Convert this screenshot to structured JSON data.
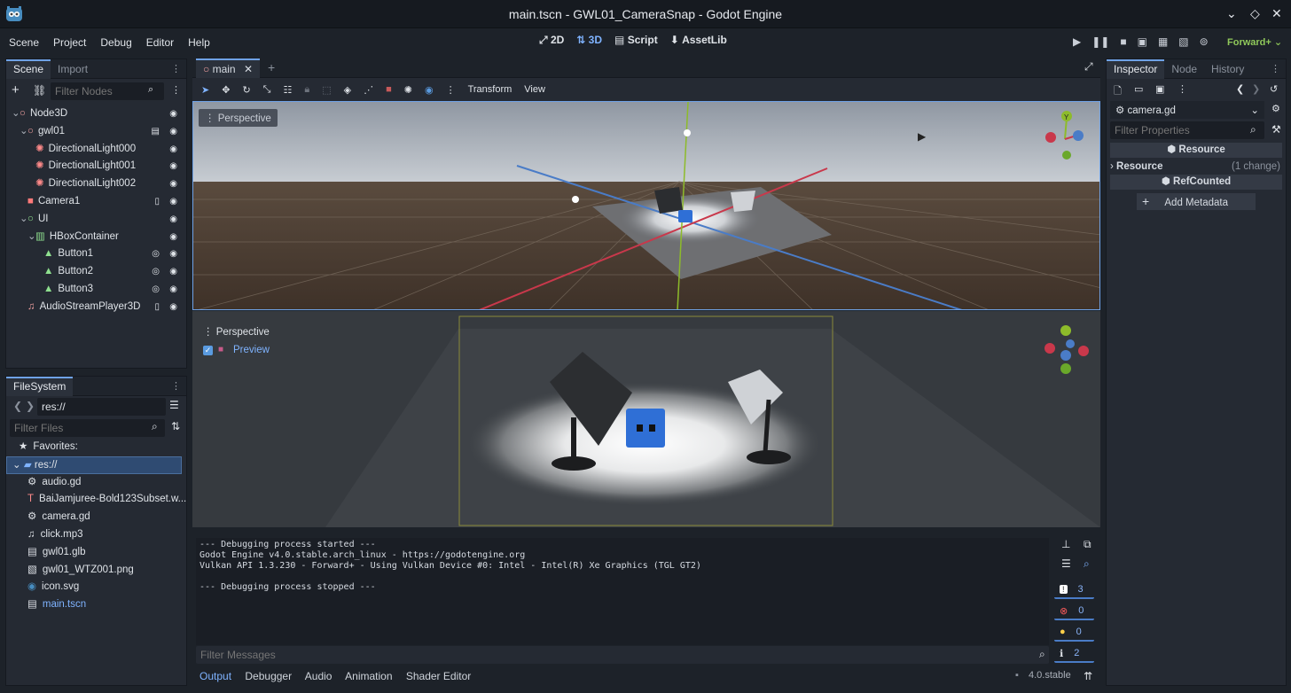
{
  "titlebar": {
    "title": "main.tscn - GWL01_CameraSnap - Godot Engine"
  },
  "menu": [
    "Scene",
    "Project",
    "Debug",
    "Editor",
    "Help"
  ],
  "workspaces": [
    "2D",
    "3D",
    "Script",
    "AssetLib"
  ],
  "renderer": "Forward+",
  "scene_dock": {
    "tabs": [
      "Scene",
      "Import"
    ],
    "filter_placeholder": "Filter Nodes",
    "nodes": [
      {
        "label": "Node3D",
        "indent": 0,
        "icon": "node3d-icon",
        "color": "#f0a0a0",
        "arrow": "⌄",
        "badge": ""
      },
      {
        "label": "gwl01",
        "indent": 1,
        "icon": "node3d-icon",
        "color": "#f0a0a0",
        "arrow": "⌄",
        "badge": "clapper"
      },
      {
        "label": "DirectionalLight000",
        "indent": 2,
        "icon": "light-icon",
        "color": "#ff8a8a",
        "arrow": "",
        "badge": ""
      },
      {
        "label": "DirectionalLight001",
        "indent": 2,
        "icon": "light-icon",
        "color": "#ff8a8a",
        "arrow": "",
        "badge": ""
      },
      {
        "label": "DirectionalLight002",
        "indent": 2,
        "icon": "light-icon",
        "color": "#ff8a8a",
        "arrow": "",
        "badge": ""
      },
      {
        "label": "Camera1",
        "indent": 1,
        "icon": "camera-icon",
        "color": "#ff7a7a",
        "arrow": "",
        "badge": "script"
      },
      {
        "label": "UI",
        "indent": 1,
        "icon": "control-icon",
        "color": "#8fe08f",
        "arrow": "⌄",
        "badge": ""
      },
      {
        "label": "HBoxContainer",
        "indent": 2,
        "icon": "hbox-icon",
        "color": "#8fe08f",
        "arrow": "⌄",
        "badge": ""
      },
      {
        "label": "Button1",
        "indent": 3,
        "icon": "button-icon",
        "color": "#8fe08f",
        "arrow": "",
        "badge": "signal"
      },
      {
        "label": "Button2",
        "indent": 3,
        "icon": "button-icon",
        "color": "#8fe08f",
        "arrow": "",
        "badge": "signal"
      },
      {
        "label": "Button3",
        "indent": 3,
        "icon": "button-icon",
        "color": "#8fe08f",
        "arrow": "",
        "badge": "signal"
      },
      {
        "label": "AudioStreamPlayer3D",
        "indent": 1,
        "icon": "audio-icon",
        "color": "#f0a0a0",
        "arrow": "",
        "badge": "script"
      }
    ]
  },
  "filesystem": {
    "tab": "FileSystem",
    "path": "res://",
    "filter_placeholder": "Filter Files",
    "favorites_label": "Favorites:",
    "root_label": "res://",
    "files": [
      {
        "label": "audio.gd",
        "icon": "gear-icon",
        "color": "#dfe3e8"
      },
      {
        "label": "BaiJamjuree-Bold123Subset.w...",
        "icon": "font-icon",
        "color": "#dfe3e8"
      },
      {
        "label": "camera.gd",
        "icon": "gear-icon",
        "color": "#dfe3e8"
      },
      {
        "label": "click.mp3",
        "icon": "music-icon",
        "color": "#dfe3e8"
      },
      {
        "label": "gwl01.glb",
        "icon": "scene-icon",
        "color": "#dfe3e8"
      },
      {
        "label": "gwl01_WTZ001.png",
        "icon": "image-icon",
        "color": "#dfe3e8"
      },
      {
        "label": "icon.svg",
        "icon": "godot-icon",
        "color": "#dfe3e8"
      },
      {
        "label": "main.tscn",
        "icon": "scene-icon",
        "color": "#7fb3ff"
      }
    ]
  },
  "editor_tab": "main",
  "viewport_toolbar": {
    "transform_label": "Transform",
    "view_label": "View"
  },
  "viewport_top": {
    "label": "Perspective"
  },
  "viewport_bottom": {
    "label": "Perspective",
    "preview_label": "Preview"
  },
  "gizmo": {
    "y": "Y",
    "x": "X",
    "z": "Z"
  },
  "console": {
    "lines": [
      "--- Debugging process started ---",
      "Godot Engine v4.0.stable.arch_linux - https://godotengine.org",
      "Vulkan API 1.3.230 - Forward+ - Using Vulkan Device #0: Intel - Intel(R) Xe Graphics (TGL GT2)",
      "",
      "--- Debugging process stopped ---"
    ],
    "filter_placeholder": "Filter Messages",
    "counts": {
      "messages": "3",
      "errors": "0",
      "warnings": "0",
      "info": "2"
    }
  },
  "bottom_tabs": [
    "Output",
    "Debugger",
    "Audio",
    "Animation",
    "Shader Editor"
  ],
  "version": "4.0.stable",
  "inspector": {
    "tabs": [
      "Inspector",
      "Node",
      "History"
    ],
    "resource_name": "camera.gd",
    "filter_placeholder": "Filter Properties",
    "section_resource": "Resource",
    "prop_resource": "Resource",
    "prop_changes": "(1 change)",
    "section_refcounted": "RefCounted",
    "add_metadata": "Add Metadata"
  }
}
